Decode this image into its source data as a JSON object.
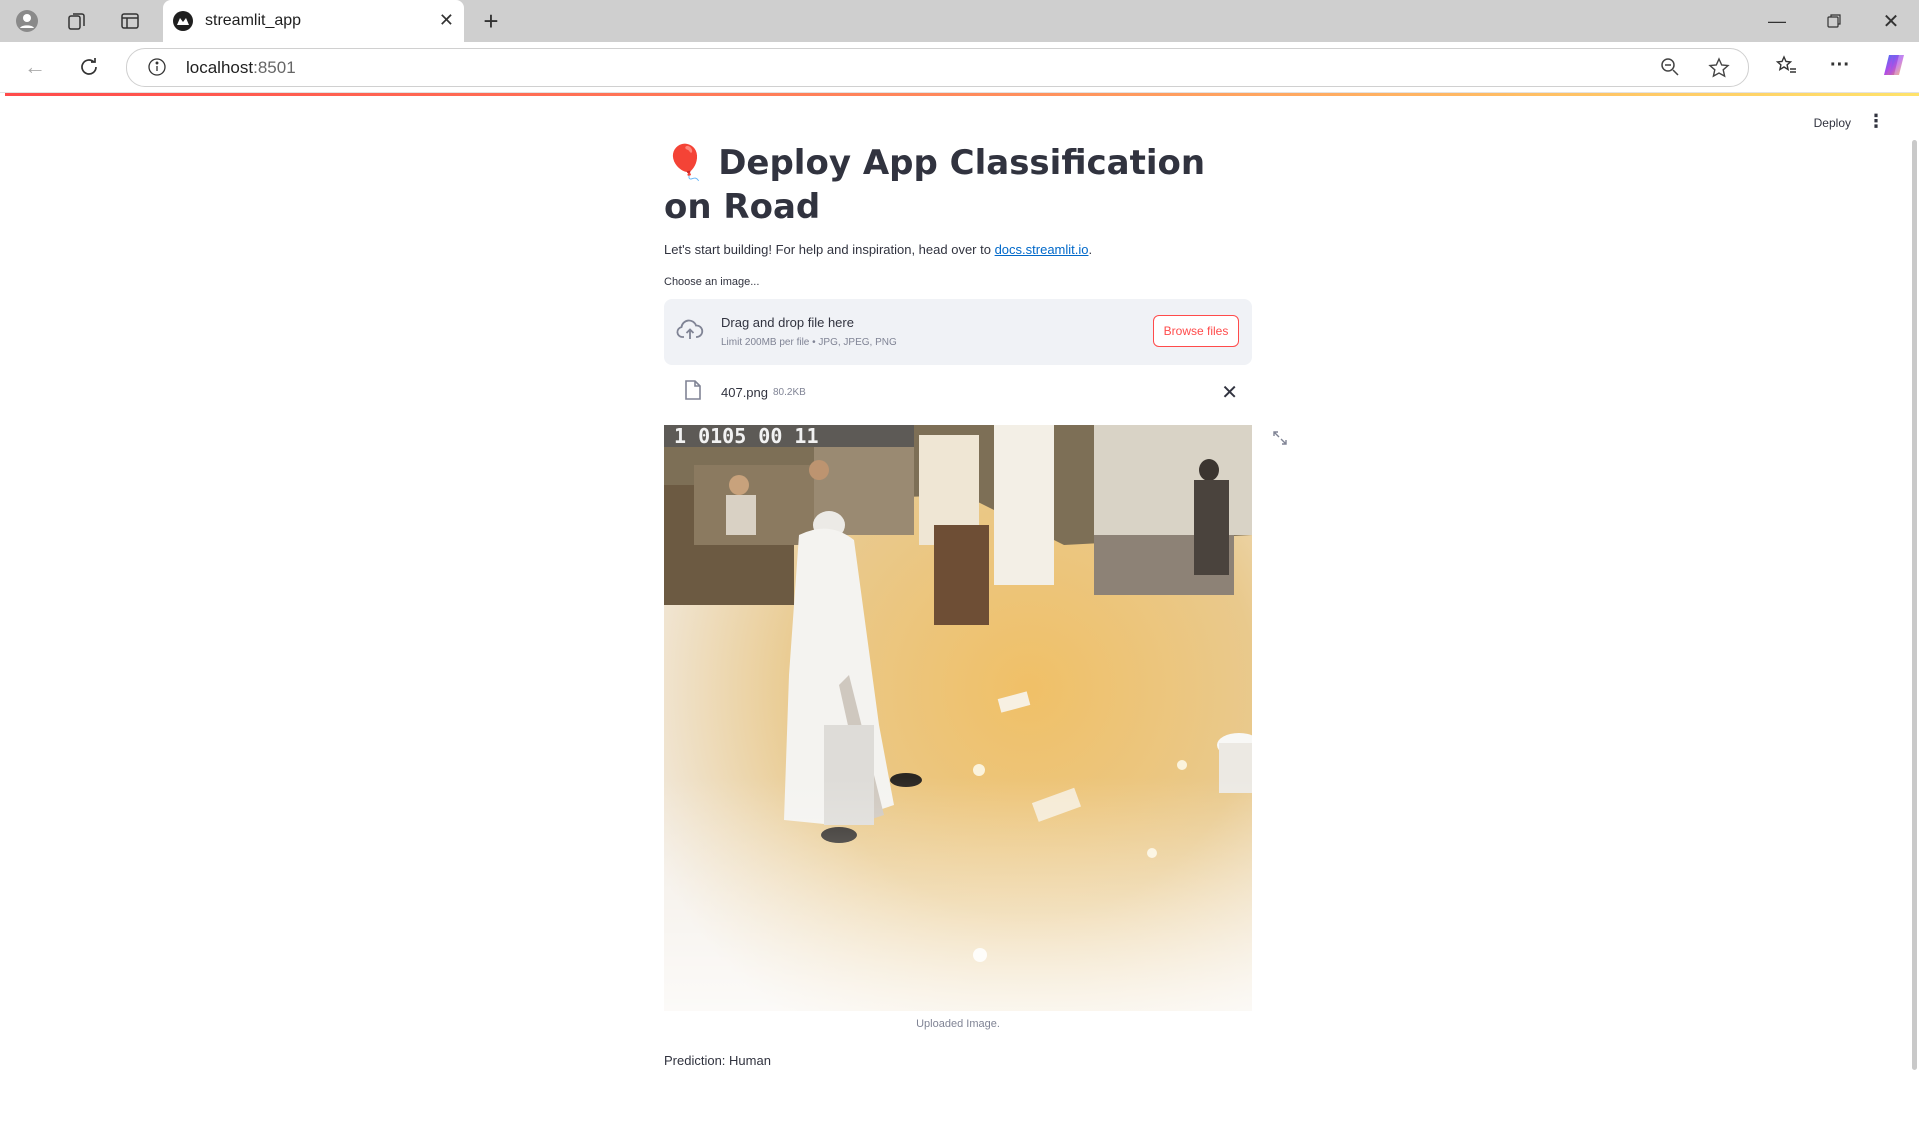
{
  "browser": {
    "tab_title": "streamlit_app",
    "url_host": "localhost",
    "url_port": ":8501"
  },
  "app": {
    "deploy_label": "Deploy",
    "title_emoji": "🎈",
    "title_text": "Deploy App Classification on Road",
    "intro_text": "Let's start building! For help and inspiration, head over to ",
    "intro_link": "docs.streamlit.io",
    "intro_end": ".",
    "uploader": {
      "label": "Choose an image...",
      "drop_title": "Drag and drop file here",
      "drop_limit": "Limit 200MB per file • JPG, JPEG, PNG",
      "browse_label": "Browse files"
    },
    "file": {
      "name": "407.png",
      "size": "80.2KB"
    },
    "image_caption": "Uploaded Image.",
    "prediction": "Prediction: Human",
    "colors": {
      "accent": "#ff4b4b",
      "link": "#0068c9",
      "text": "#31333f",
      "dropzone_bg": "#f0f2f6"
    }
  }
}
